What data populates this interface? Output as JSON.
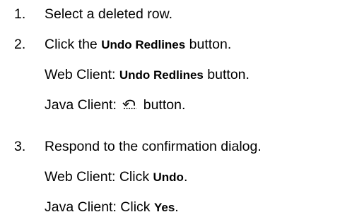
{
  "steps": [
    {
      "number": "1.",
      "text": "Select a deleted row."
    },
    {
      "number": "2.",
      "pre": "Click the ",
      "bold": "Undo Redlines",
      "post": " button.",
      "web": {
        "prefix": "Web Client: ",
        "bold": "Undo Redlines",
        "suffix": " button."
      },
      "java": {
        "prefix": "Java Client: ",
        "icon": "undo-redlines-icon",
        "suffix": " button."
      }
    },
    {
      "number": "3.",
      "text": "Respond to the confirmation dialog.",
      "web": {
        "prefix": "Web Client: Click ",
        "bold": "Undo",
        "suffix": "."
      },
      "java": {
        "prefix": "Java Client: Click ",
        "bold": "Yes",
        "suffix": "."
      }
    }
  ]
}
